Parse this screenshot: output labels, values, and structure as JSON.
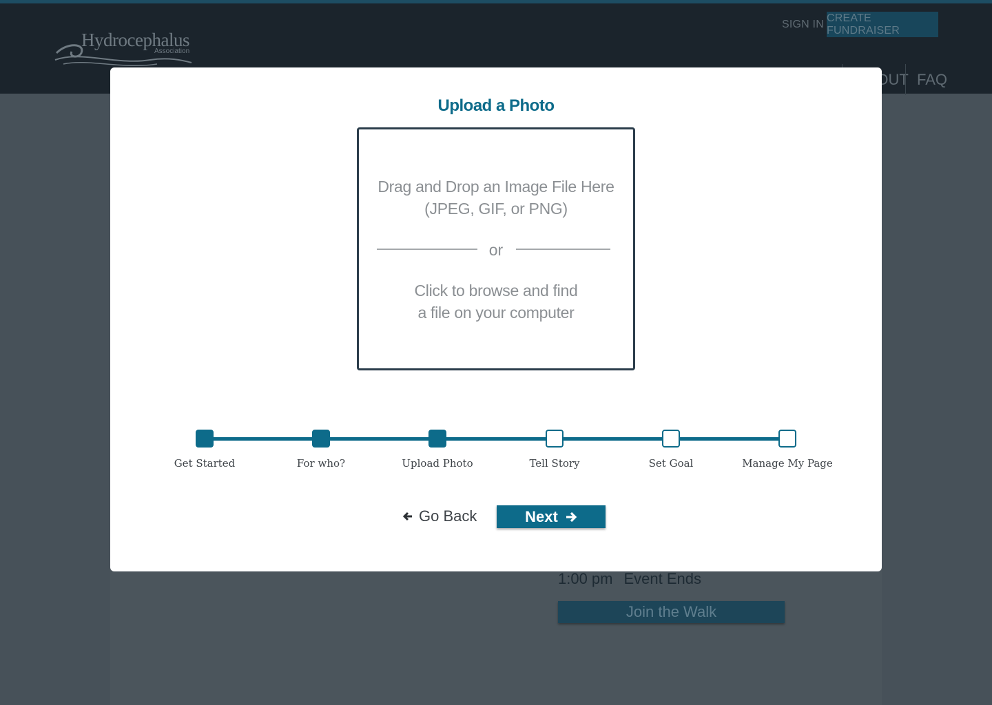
{
  "header": {
    "logo_name": "Hydrocephalus",
    "logo_sub": "Association",
    "sign_in": "SIGN IN",
    "create_fundraiser": "CREATE FUNDRAISER",
    "nav": {
      "about": "ABOUT",
      "faq": "FAQ"
    }
  },
  "background": {
    "event_time": "1:00 pm",
    "event_label": "Event Ends",
    "join_button": "Join the Walk"
  },
  "modal": {
    "title": "Upload a Photo",
    "dropzone": {
      "line1": "Drag and Drop an Image File Here",
      "line2": "(JPEG, GIF, or PNG)",
      "or": "or",
      "line3": "Click to browse and find",
      "line4": "a file on your computer"
    },
    "steps": [
      {
        "label": "Get Started",
        "completed": true
      },
      {
        "label": "For who?",
        "completed": true
      },
      {
        "label": "Upload Photo",
        "completed": true
      },
      {
        "label": "Tell Story",
        "completed": false
      },
      {
        "label": "Set Goal",
        "completed": false
      },
      {
        "label": "Manage My Page",
        "completed": false
      }
    ],
    "go_back": "Go Back",
    "next": "Next"
  },
  "colors": {
    "accent": "#0d6b8a",
    "header_bg": "#1b242c",
    "overlay_bg": "#475159",
    "dropzone_border": "#2b3d4b"
  }
}
